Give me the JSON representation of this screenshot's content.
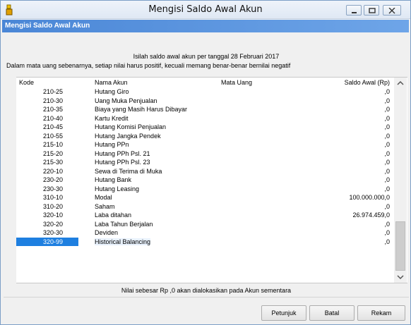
{
  "window": {
    "title": "Mengisi Saldo Awal Akun",
    "subtitle": "Mengisi Saldo Awal Akun"
  },
  "instructions": {
    "line1": "Isilah saldo awal akun per tanggal 28 Februari 2017",
    "line2": "Dalam mata uang sebenarnya, setiap nilai harus positif, kecuali memang benar-benar bernilai negatif"
  },
  "table": {
    "columns": [
      "Kode",
      "Nama Akun",
      "Mata Uang",
      "Saldo Awal (Rp)"
    ],
    "rows": [
      {
        "kode": "210-25",
        "nama": "Hutang Giro",
        "saldo": ",0"
      },
      {
        "kode": "210-30",
        "nama": "Uang Muka Penjualan",
        "saldo": ",0"
      },
      {
        "kode": "210-35",
        "nama": "Biaya yang Masih Harus Dibayar",
        "saldo": ",0"
      },
      {
        "kode": "210-40",
        "nama": "Kartu Kredit",
        "saldo": ",0"
      },
      {
        "kode": "210-45",
        "nama": "Hutang Komisi Penjualan",
        "saldo": ",0"
      },
      {
        "kode": "210-55",
        "nama": "Hutang Jangka Pendek",
        "saldo": ",0"
      },
      {
        "kode": "215-10",
        "nama": "Hutang PPn",
        "saldo": ",0"
      },
      {
        "kode": "215-20",
        "nama": "Hutang PPh Psl. 21",
        "saldo": ",0"
      },
      {
        "kode": "215-30",
        "nama": "Hutang PPh Psl. 23",
        "saldo": ",0"
      },
      {
        "kode": "220-10",
        "nama": "Sewa di Terima di Muka",
        "saldo": ",0"
      },
      {
        "kode": "230-20",
        "nama": "Hutang Bank",
        "saldo": ",0"
      },
      {
        "kode": "230-30",
        "nama": "Hutang Leasing",
        "saldo": ",0"
      },
      {
        "kode": "310-10",
        "nama": "Modal",
        "saldo": "100.000.000,0"
      },
      {
        "kode": "310-20",
        "nama": "Saham",
        "saldo": ",0"
      },
      {
        "kode": "320-10",
        "nama": "Laba ditahan",
        "saldo": "26.974.459,0"
      },
      {
        "kode": "320-20",
        "nama": "Laba Tahun Berjalan",
        "saldo": ",0"
      },
      {
        "kode": "320-30",
        "nama": "Deviden",
        "saldo": ",0"
      },
      {
        "kode": "320-99",
        "nama": "Historical Balancing",
        "saldo": ",0",
        "selected": true
      }
    ]
  },
  "footer": {
    "note": "Nilai sebesar Rp ,0 akan dialokasikan pada Akun sementara"
  },
  "buttons": {
    "help": "Petunjuk",
    "cancel": "Batal",
    "save": "Rekam"
  },
  "colors": {
    "subtitle_bar": "#4a86d6",
    "selection": "#1e7fe0"
  }
}
